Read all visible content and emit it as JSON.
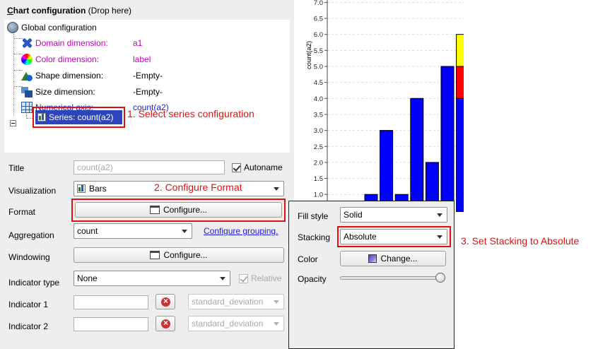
{
  "tree": {
    "header_underlined": "C",
    "header_bold": "hart configuration",
    "header_rest": " (Drop here)",
    "nodes": [
      {
        "label": "Global configuration",
        "value": ""
      },
      {
        "label": "Domain dimension:",
        "value": "a1"
      },
      {
        "label": "Color dimension:",
        "value": "label"
      },
      {
        "label": "Shape dimension:",
        "value": "-Empty-"
      },
      {
        "label": "Size dimension:",
        "value": "-Empty-"
      },
      {
        "label": "Numerical axis:",
        "value": "count(a2)"
      }
    ],
    "series_node": "Series: count(a2)"
  },
  "annotations": {
    "step1": "1. Select series configuration",
    "step2": "2. Configure Format",
    "step3": "3. Set Stacking to Absolute"
  },
  "form": {
    "title_label": "Title",
    "title_value": "count(a2)",
    "autoname_label": "Autoname",
    "visualization_label": "Visualization",
    "visualization_value": "Bars",
    "format_label": "Format",
    "configure_label": "Configure...",
    "aggregation_label": "Aggregation",
    "aggregation_value": "count",
    "configure_grouping_label": "Configure grouping.",
    "windowing_label": "Windowing",
    "indicator_type_label": "Indicator type",
    "indicator_type_value": "None",
    "relative_label": "Relative",
    "indicator1_label": "Indicator 1",
    "indicator2_label": "Indicator 2",
    "std_dev_value": "standard_deviation"
  },
  "popup": {
    "fill_style_label": "Fill style",
    "fill_style_value": "Solid",
    "stacking_label": "Stacking",
    "stacking_value": "Absolute",
    "color_label": "Color",
    "change_label": "Change...",
    "opacity_label": "Opacity",
    "opacity_value": 1.0
  },
  "chart_data": {
    "type": "bar",
    "ylabel": "count(a2)",
    "y_ticks": [
      "1.0",
      "1.5",
      "2.0",
      "2.5",
      "3.0",
      "3.5",
      "4.0",
      "4.5",
      "5.0",
      "5.5",
      "6.0",
      "6.5",
      "7.0"
    ],
    "ylim": [
      0.0,
      7.0
    ],
    "grid": true,
    "series": [
      {
        "values": [
          1,
          3,
          1,
          4,
          2,
          5,
          4
        ],
        "color": "#0000ff"
      },
      {
        "values": [
          0,
          0,
          0,
          0,
          0,
          0,
          1
        ],
        "color": "#ff0000"
      },
      {
        "values": [
          0,
          0,
          0,
          0,
          0,
          0,
          1
        ],
        "color": "#ffff00"
      }
    ]
  }
}
